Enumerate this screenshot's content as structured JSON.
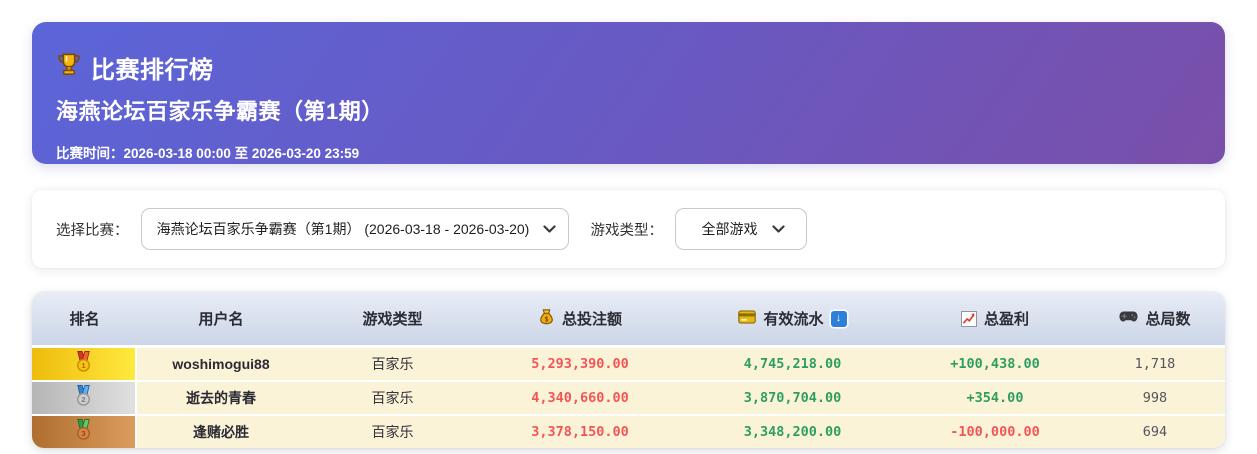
{
  "banner": {
    "icon": "trophy-icon",
    "title": "比赛排行榜",
    "subtitle": "海燕论坛百家乐争霸赛（第1期）",
    "time_label": "比赛时间：",
    "time_value": "2026-03-18 00:00 至 2026-03-20 23:59"
  },
  "filters": {
    "competition": {
      "label": "选择比赛：",
      "selected": "海燕论坛百家乐争霸赛（第1期） (2026-03-18 - 2026-03-20)"
    },
    "game_type": {
      "label": "游戏类型：",
      "selected": "全部游戏"
    }
  },
  "table": {
    "columns": {
      "rank": {
        "label": "排名"
      },
      "username": {
        "label": "用户名"
      },
      "game_type": {
        "label": "游戏类型"
      },
      "total_bet": {
        "label": "总投注额",
        "icon": "money-bag-icon"
      },
      "valid_turnover": {
        "label": "有效流水",
        "icon": "credit-card-icon",
        "sort_icon": "sort-descending-icon",
        "sort_glyph": "↓"
      },
      "total_profit": {
        "label": "总盈利",
        "icon": "chart-up-icon"
      },
      "total_rounds": {
        "label": "总局数",
        "icon": "game-controller-icon"
      }
    },
    "rows": [
      {
        "rank": 1,
        "medal": "gold-medal-icon",
        "medal_number": "1",
        "username": "woshimogui88",
        "game_type": "百家乐",
        "total_bet": "5,293,390.00",
        "valid_turnover": "4,745,218.00",
        "total_profit": "+100,438.00",
        "profit_sign": "positive",
        "total_rounds": "1,718"
      },
      {
        "rank": 2,
        "medal": "silver-medal-icon",
        "medal_number": "2",
        "username": "逝去的青春",
        "game_type": "百家乐",
        "total_bet": "4,340,660.00",
        "valid_turnover": "3,870,704.00",
        "total_profit": "+354.00",
        "profit_sign": "positive",
        "total_rounds": "998"
      },
      {
        "rank": 3,
        "medal": "bronze-medal-icon",
        "medal_number": "3",
        "username": "逢赌必胜",
        "game_type": "百家乐",
        "total_bet": "3,378,150.00",
        "valid_turnover": "3,348,200.00",
        "total_profit": "-100,000.00",
        "profit_sign": "negative",
        "total_rounds": "694"
      }
    ]
  },
  "colors": {
    "banner_gradient_start": "#5b65d8",
    "banner_gradient_end": "#7a4fa9",
    "table_header_top": "#e8ecf5",
    "table_header_bottom": "#ccd6e8",
    "row_background": "#fbf3d8",
    "negative_red": "#f25555",
    "positive_green": "#2e9e60",
    "gold_cell": "#ffe93e",
    "silver_cell": "#e0e0e0",
    "bronze_cell": "#db9c5e",
    "sort_badge_blue": "#2e7fd9"
  }
}
